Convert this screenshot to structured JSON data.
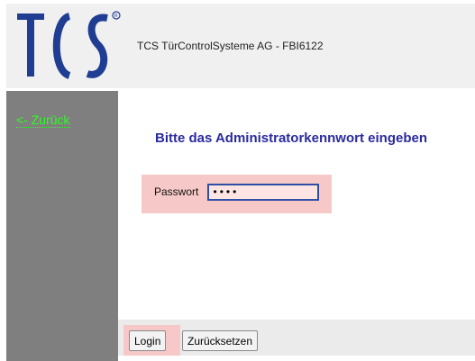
{
  "header": {
    "logo_text": "TCS",
    "company": "TCS TürControlSysteme AG - FBI6122"
  },
  "sidebar": {
    "back_label": "<- Zurück"
  },
  "main": {
    "title": "Bitte das Administratorkennwort eingeben",
    "password": {
      "label": "Passwort",
      "value": "••••"
    }
  },
  "footer": {
    "login_label": "Login",
    "reset_label": "Zurücksetzen"
  },
  "colors": {
    "brand": "#1f3d93",
    "sidebar": "#7f7f7f",
    "link": "#2cff20",
    "title": "#2a2aa0",
    "highlight": "#f6c8c8"
  }
}
